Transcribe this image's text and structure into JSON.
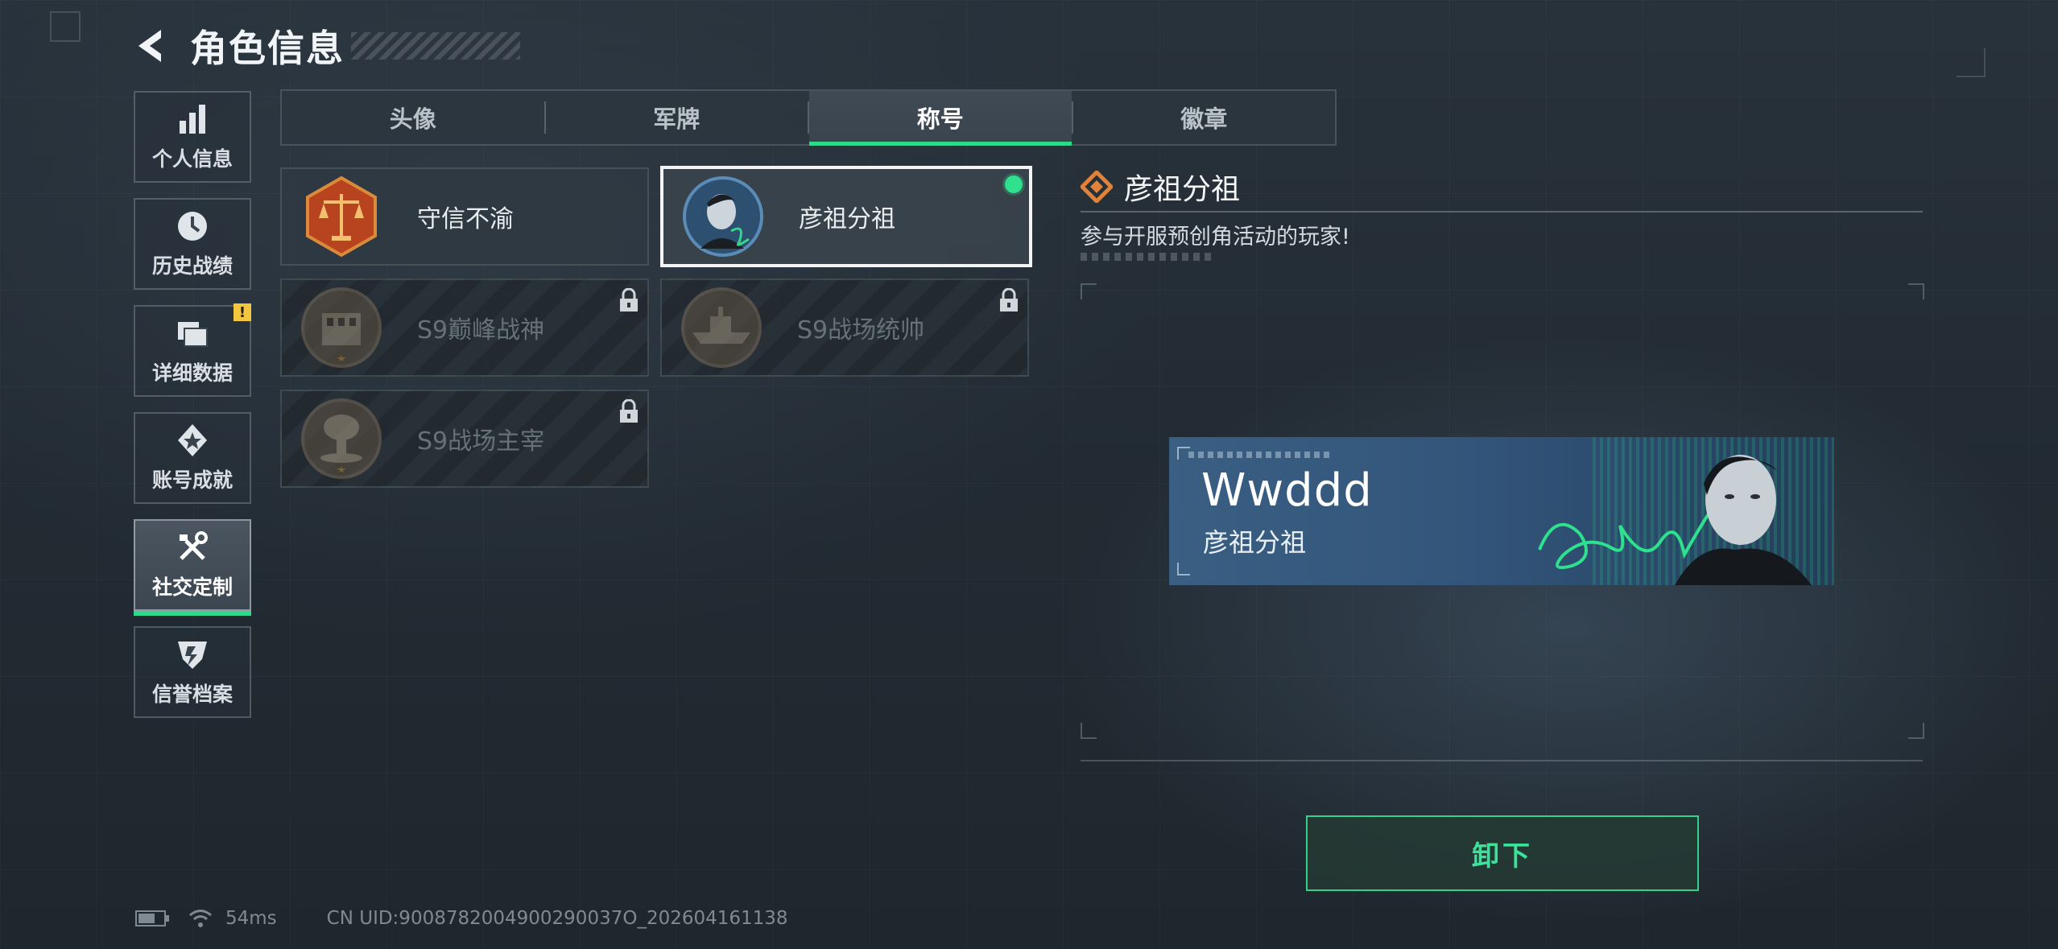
{
  "header": {
    "title": "角色信息"
  },
  "sidebar": {
    "items": [
      {
        "label": "个人信息",
        "icon": "bar-chart-icon"
      },
      {
        "label": "历史战绩",
        "icon": "clock-icon"
      },
      {
        "label": "详细数据",
        "icon": "folder-icon",
        "badge": "!"
      },
      {
        "label": "账号成就",
        "icon": "achievement-icon"
      },
      {
        "label": "社交定制",
        "icon": "tools-icon",
        "active": true
      },
      {
        "label": "信誉档案",
        "icon": "shield-icon"
      }
    ]
  },
  "tabs": [
    {
      "label": "头像"
    },
    {
      "label": "军牌"
    },
    {
      "label": "称号",
      "active": true
    },
    {
      "label": "徽章"
    }
  ],
  "titles": [
    {
      "name": "守信不渝",
      "locked": false,
      "selected": false,
      "icon": "scales-medal-icon"
    },
    {
      "name": "彦祖分祖",
      "locked": false,
      "selected": true,
      "equipped": true,
      "icon": "portrait-medal-icon"
    },
    {
      "name": "S9巅峰战神",
      "locked": true,
      "icon": "building-medal-icon"
    },
    {
      "name": "S9战场统帅",
      "locked": true,
      "icon": "ship-medal-icon"
    },
    {
      "name": "S9战场主宰",
      "locked": true,
      "icon": "explosion-medal-icon"
    }
  ],
  "detail": {
    "name": "彦祖分祖",
    "description": "参与开服预创角活动的玩家!",
    "banner": {
      "player_name": "Wwddd",
      "title": "彦祖分祖"
    },
    "button_label": "卸下"
  },
  "status_bar": {
    "ping": "54ms",
    "uid": "CN UID:9008782004900290037O_202604161138"
  },
  "colors": {
    "accent": "#2fd98a",
    "badge": "#f3c63f",
    "diamond": "#e0823a"
  }
}
